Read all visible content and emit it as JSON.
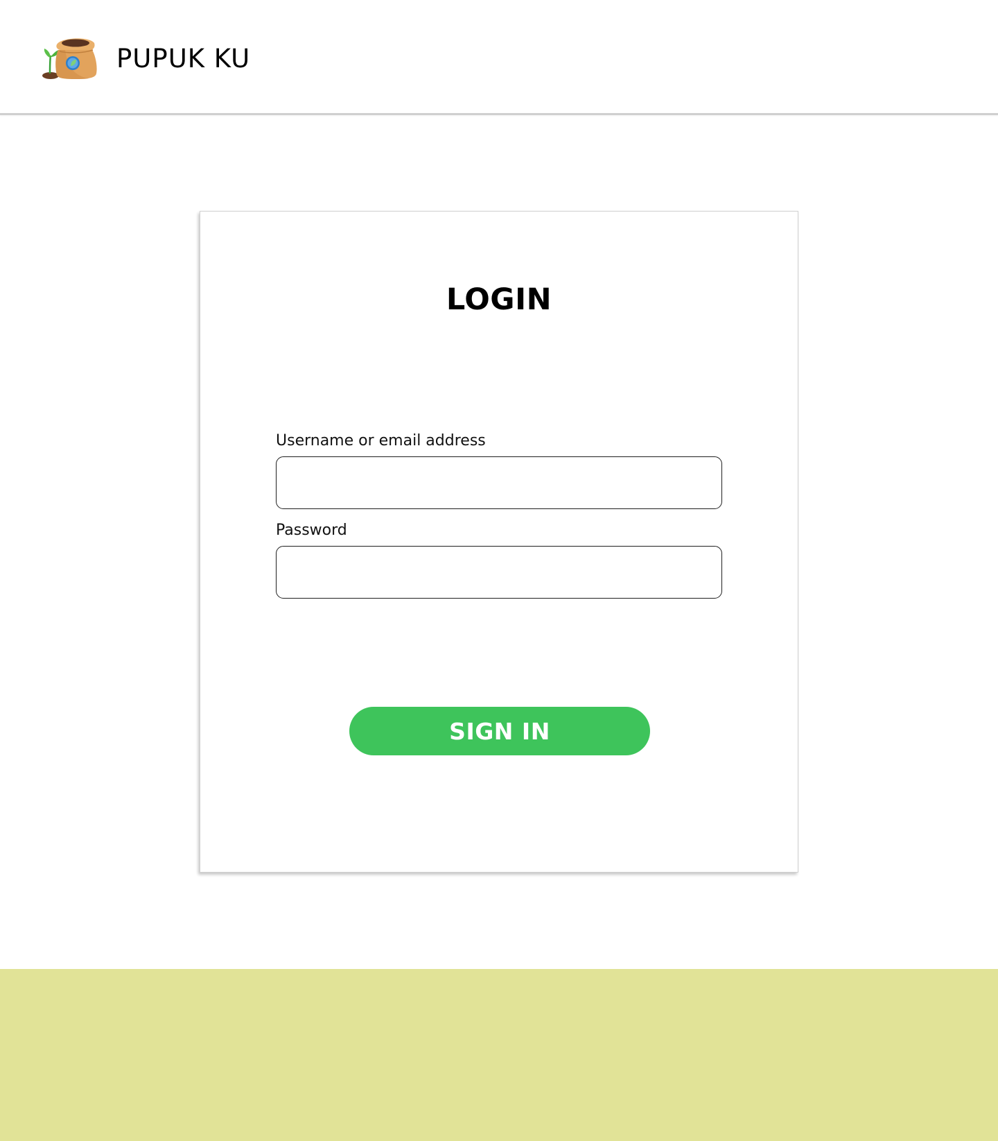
{
  "header": {
    "brand_name": "PUPUK KU",
    "logo_icon": "fertilizer-sack-icon"
  },
  "login": {
    "title": "LOGIN",
    "username_label": "Username or email address",
    "username_value": "",
    "password_label": "Password",
    "password_value": "",
    "submit_label": "SIGN IN"
  },
  "colors": {
    "accent_button": "#3ec45b",
    "footer_band": "#e1e397",
    "header_border": "#cfcfcf"
  }
}
